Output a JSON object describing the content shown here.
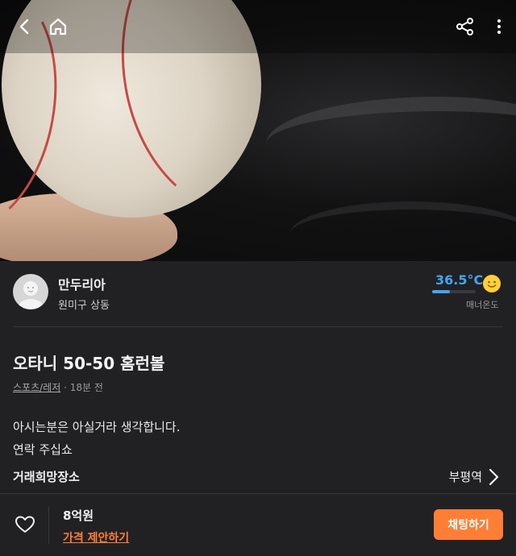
{
  "header": {
    "back_icon": "chevron-left-icon",
    "home_icon": "home-icon",
    "share_icon": "share-icon",
    "more_icon": "more-vertical-icon"
  },
  "seller": {
    "name": "만두리아",
    "location": "원미구 상동",
    "temperature": "36.5°C",
    "temperature_label": "매너온도"
  },
  "post": {
    "title": "오타니 50-50 홈런볼",
    "category": "스포츠/레저",
    "time": " · 18분 전",
    "description_line1": "아시는분은 아실거라 생각합니다.",
    "description_line2": "연락 주십쇼"
  },
  "place": {
    "label": "거래희망장소",
    "value": "부평역"
  },
  "bottom": {
    "price": "8억원",
    "offer_link": "가격 제안하기",
    "chat_button": "채팅하기"
  },
  "colors": {
    "accent": "#ff7e36",
    "temperature": "#43a6f0",
    "background": "#212124"
  }
}
